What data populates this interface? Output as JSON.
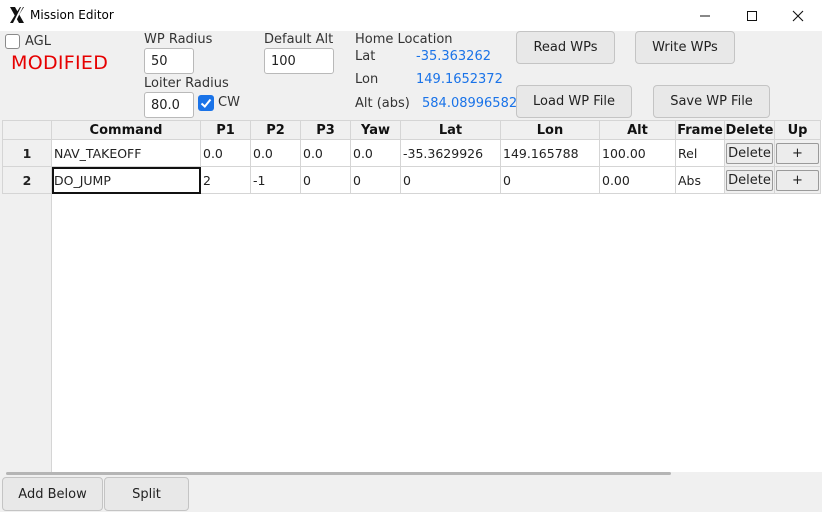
{
  "window": {
    "title": "Mission Editor",
    "icon": "x-logo-icon",
    "controls": [
      "minimize-icon",
      "maximize-icon",
      "close-icon"
    ]
  },
  "form": {
    "agl_label": "AGL",
    "agl_checked": false,
    "modified_text": "MODIFIED",
    "wp_radius_label": "WP Radius",
    "wp_radius_value": "50",
    "loiter_radius_label": "Loiter Radius",
    "loiter_radius_value": "80.0",
    "cw_label": "CW",
    "cw_checked": true,
    "default_alt_label": "Default Alt",
    "default_alt_value": "100",
    "home_location_label": "Home Location",
    "lat_label": "Lat",
    "lat_value": "-35.363262",
    "lon_label": "Lon",
    "lon_value": "149.1652372",
    "alt_label": "Alt (abs)",
    "alt_value": "584.0899658203125"
  },
  "buttons": {
    "read_wps": "Read WPs",
    "write_wps": "Write WPs",
    "load_wp_file": "Load WP File",
    "save_wp_file": "Save WP File",
    "add_below": "Add Below",
    "split": "Split"
  },
  "table": {
    "columns": [
      "Command",
      "P1",
      "P2",
      "P3",
      "Yaw",
      "Lat",
      "Lon",
      "Alt",
      "Frame",
      "Delete",
      "Up"
    ],
    "rows": [
      {
        "num": "1",
        "command": "NAV_TAKEOFF",
        "p1": "0.0",
        "p2": "0.0",
        "p3": "0.0",
        "yaw": "0.0",
        "lat": "-35.3629926",
        "lon": "149.165788",
        "alt": "100.00",
        "frame": "Rel",
        "delete": "Delete",
        "up": "+"
      },
      {
        "num": "2",
        "command": "DO_JUMP",
        "p1": "2",
        "p2": "-1",
        "p3": "0",
        "yaw": "0",
        "lat": "0",
        "lon": "0",
        "alt": "0.00",
        "frame": "Abs",
        "delete": "Delete",
        "up": "+"
      }
    ]
  },
  "colors": {
    "modified": "#e60000",
    "home_values": "#1a73e8",
    "checkbox_checked": "#1a73e8"
  }
}
